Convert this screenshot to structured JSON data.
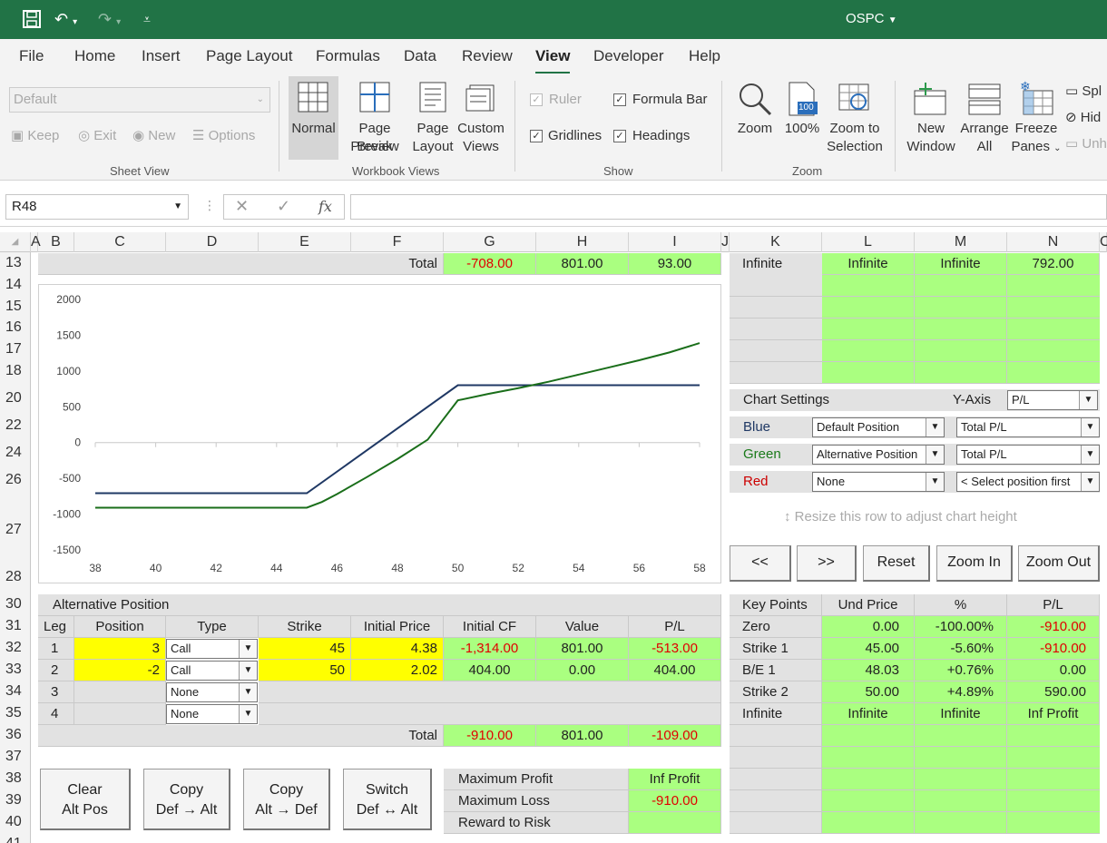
{
  "title": "OSPC",
  "menu": [
    "File",
    "Home",
    "Insert",
    "Page Layout",
    "Formulas",
    "Data",
    "Review",
    "View",
    "Developer",
    "Help"
  ],
  "ribbon": {
    "sheet_view": {
      "dropdown": "Default",
      "keep": "Keep",
      "exit": "Exit",
      "new": "New",
      "options": "Options",
      "label": "Sheet View"
    },
    "workbook_views": {
      "normal": "Normal",
      "page_break": [
        "Page Break",
        "Preview"
      ],
      "page_layout": [
        "Page",
        "Layout"
      ],
      "custom_views": [
        "Custom",
        "Views"
      ],
      "label": "Workbook Views"
    },
    "show": {
      "ruler": "Ruler",
      "formula_bar": "Formula Bar",
      "gridlines": "Gridlines",
      "headings": "Headings",
      "label": "Show"
    },
    "zoom": {
      "zoom": "Zoom",
      "hundred": "100%",
      "hundred_badge": "100",
      "zoom_sel": [
        "Zoom to",
        "Selection"
      ],
      "label": "Zoom"
    },
    "window": {
      "new_window": [
        "New",
        "Window"
      ],
      "arrange": [
        "Arrange",
        "All"
      ],
      "freeze": [
        "Freeze",
        "Panes"
      ],
      "split": "Spl",
      "hide": "Hid",
      "unhide": "Unh"
    }
  },
  "namebox": "R48",
  "fx": "fx",
  "columns": [
    "A",
    "B",
    "C",
    "D",
    "E",
    "F",
    "G",
    "H",
    "I",
    "J",
    "K",
    "L",
    "M",
    "N",
    "O"
  ],
  "rows": [
    "13",
    "14",
    "15",
    "16",
    "17",
    "18",
    "20",
    "22",
    "24",
    "26",
    "27",
    "28",
    "30",
    "31",
    "32",
    "33",
    "34",
    "35",
    "36",
    "37",
    "38",
    "39",
    "40",
    "41"
  ],
  "top_total": {
    "label": "Total",
    "g": "-708.00",
    "h": "801.00",
    "i": "93.00"
  },
  "right_top": {
    "k": "Infinite",
    "l": "Infinite",
    "m": "Infinite",
    "n": "792.00"
  },
  "chart_settings": {
    "title": "Chart Settings",
    "yaxis_label": "Y-Axis",
    "yaxis": "P/L",
    "rows": [
      {
        "name": "Blue",
        "color": "#1f3864",
        "pos": "Default Position",
        "val": "Total P/L"
      },
      {
        "name": "Green",
        "color": "#1a7a1a",
        "pos": "Alternative Position",
        "val": "Total P/L"
      },
      {
        "name": "Red",
        "color": "#cc0000",
        "pos": "None",
        "val": "< Select position first"
      }
    ],
    "resize_hint": "Resize this row to adjust chart height"
  },
  "zoom_buttons": [
    "<<",
    ">>",
    "Reset",
    "Zoom In",
    "Zoom Out"
  ],
  "alt": {
    "title": "Alternative Position",
    "headers": [
      "Leg",
      "Position",
      "Type",
      "Strike",
      "Initial Price",
      "Initial CF",
      "Value",
      "P/L"
    ],
    "rows": [
      {
        "leg": "1",
        "position": "3",
        "type": "Call",
        "strike": "45",
        "price": "4.38",
        "cf": "-1,314.00",
        "value": "801.00",
        "pl": "-513.00"
      },
      {
        "leg": "2",
        "position": "-2",
        "type": "Call",
        "strike": "50",
        "price": "2.02",
        "cf": "404.00",
        "value": "0.00",
        "pl": "404.00"
      },
      {
        "leg": "3",
        "position": "",
        "type": "None",
        "strike": "",
        "price": "",
        "cf": "",
        "value": "",
        "pl": ""
      },
      {
        "leg": "4",
        "position": "",
        "type": "None",
        "strike": "",
        "price": "",
        "cf": "",
        "value": "",
        "pl": ""
      }
    ],
    "total": {
      "label": "Total",
      "cf": "-910.00",
      "value": "801.00",
      "pl": "-109.00"
    }
  },
  "key_points": {
    "headers": [
      "Key Points",
      "Und Price",
      "%",
      "P/L"
    ],
    "rows": [
      {
        "k": "Zero",
        "price": "0.00",
        "pct": "-100.00%",
        "pl": "-910.00",
        "neg": true
      },
      {
        "k": "Strike 1",
        "price": "45.00",
        "pct": "-5.60%",
        "pl": "-910.00",
        "neg": true
      },
      {
        "k": "B/E 1",
        "price": "48.03",
        "pct": "+0.76%",
        "pl": "0.00",
        "neg": false
      },
      {
        "k": "Strike 2",
        "price": "50.00",
        "pct": "+4.89%",
        "pl": "590.00",
        "neg": false
      },
      {
        "k": "Infinite",
        "price": "Infinite",
        "pct": "Infinite",
        "pl": "Inf Profit",
        "neg": false
      }
    ]
  },
  "buttons": [
    [
      "Clear",
      "Alt Pos"
    ],
    [
      "Copy",
      "Def → Alt"
    ],
    [
      "Copy",
      "Alt → Def"
    ],
    [
      "Switch",
      "Def ↔ Alt"
    ]
  ],
  "summary": [
    {
      "label": "Maximum Profit",
      "value": "Inf Profit",
      "neg": false
    },
    {
      "label": "Maximum Loss",
      "value": "-910.00",
      "neg": true
    },
    {
      "label": "Reward to Risk",
      "value": "",
      "neg": false
    }
  ],
  "chart_data": {
    "type": "line",
    "xlim": [
      38,
      58
    ],
    "ylim": [
      -1500,
      2000
    ],
    "xticks": [
      38,
      40,
      42,
      44,
      46,
      48,
      50,
      52,
      54,
      56,
      58
    ],
    "yticks": [
      2000,
      1500,
      1000,
      500,
      0,
      -500,
      -1000,
      -1500
    ],
    "series": [
      {
        "color": "#1f3864",
        "x": [
          38,
          45,
          50,
          58
        ],
        "y": [
          -708,
          -708,
          801,
          801
        ]
      },
      {
        "color": "#1a6e1a",
        "x": [
          38,
          45,
          45.5,
          46,
          47,
          48,
          49,
          50,
          51,
          52,
          53,
          54,
          55,
          56,
          57,
          58
        ],
        "y": [
          -910,
          -910,
          -830,
          -720,
          -480,
          -230,
          40,
          590,
          680,
          760,
          850,
          950,
          1050,
          1150,
          1260,
          1390
        ]
      }
    ]
  }
}
